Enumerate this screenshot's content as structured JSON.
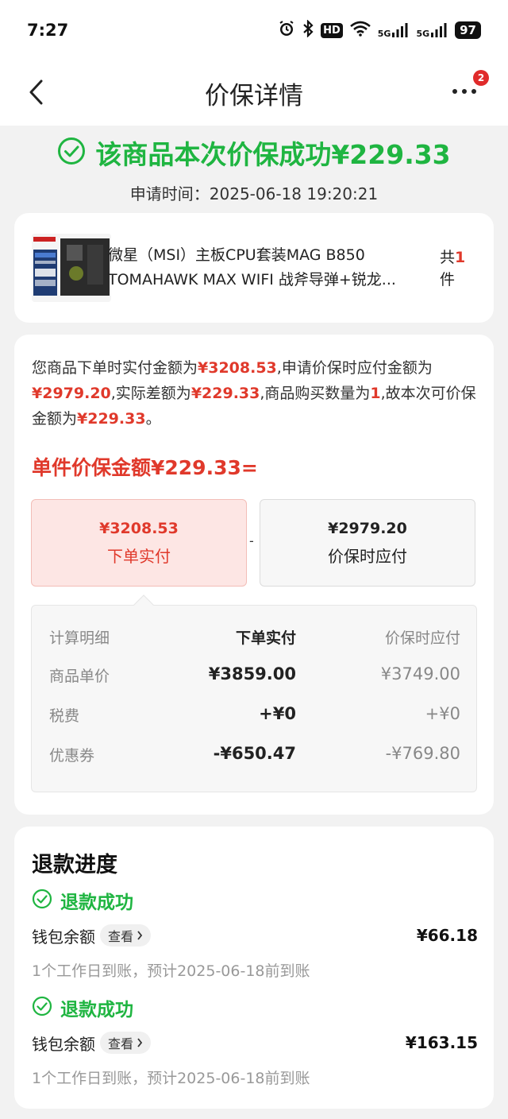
{
  "status_bar": {
    "time": "7:27",
    "hd_label": "HD",
    "net_1": "5G",
    "net_2": "5G",
    "battery": "97"
  },
  "nav": {
    "title": "价保详情",
    "badge_count": "2"
  },
  "success": {
    "headline": "该商品本次价保成功¥229.33",
    "apply_time": "申请时间：2025-06-18 19:20:21"
  },
  "product": {
    "title": "微星（MSI）主板CPU套装MAG B850 TOMAHAWK MAX WIFI 战斧导弹+锐龙...",
    "qty_prefix": "共",
    "qty_value": "1",
    "qty_suffix": "件"
  },
  "calculation": {
    "explain_parts": {
      "p1": "您商品下单时实付金额为",
      "v1": "¥3208.53",
      "p2": ",申请价保时应付金额为",
      "v2": "¥2979.20",
      "p3": ",实际差额为",
      "v3": "¥229.33",
      "p4": ",商品购买数量为",
      "v4": "1",
      "p5": ",故本次可价保金额为",
      "v5": "¥229.33",
      "p6": "。"
    },
    "single_amount": "单件价保金额¥229.33=",
    "box_left": {
      "amount": "¥3208.53",
      "label": "下单实付"
    },
    "minus": "-",
    "box_right": {
      "amount": "¥2979.20",
      "label": "价保时应付"
    },
    "detail": {
      "headers": [
        "计算明细",
        "下单实付",
        "价保时应付"
      ],
      "rows": [
        [
          "商品单价",
          "¥3859.00",
          "¥3749.00"
        ],
        [
          "税费",
          "+¥0",
          "+¥0"
        ],
        [
          "优惠券",
          "-¥650.47",
          "-¥769.80"
        ]
      ]
    }
  },
  "refund": {
    "title": "退款进度",
    "entries": [
      {
        "status": "退款成功",
        "account": "钱包余额",
        "view_label": "查看",
        "amount": "¥66.18",
        "note": "1个工作日到账，预计2025-06-18前到账"
      },
      {
        "status": "退款成功",
        "account": "钱包余额",
        "view_label": "查看",
        "amount": "¥163.15",
        "note": "1个工作日到账，预计2025-06-18前到账"
      }
    ]
  },
  "colors": {
    "success_green": "#1fb541",
    "price_red": "#e0392b",
    "badge_red": "#e02b2b"
  },
  "icons": [
    "alarm-icon",
    "bluetooth-icon",
    "wifi-icon",
    "signal-icon",
    "back-arrow-icon",
    "more-icon",
    "check-circle-icon",
    "chevron-right-icon"
  ]
}
